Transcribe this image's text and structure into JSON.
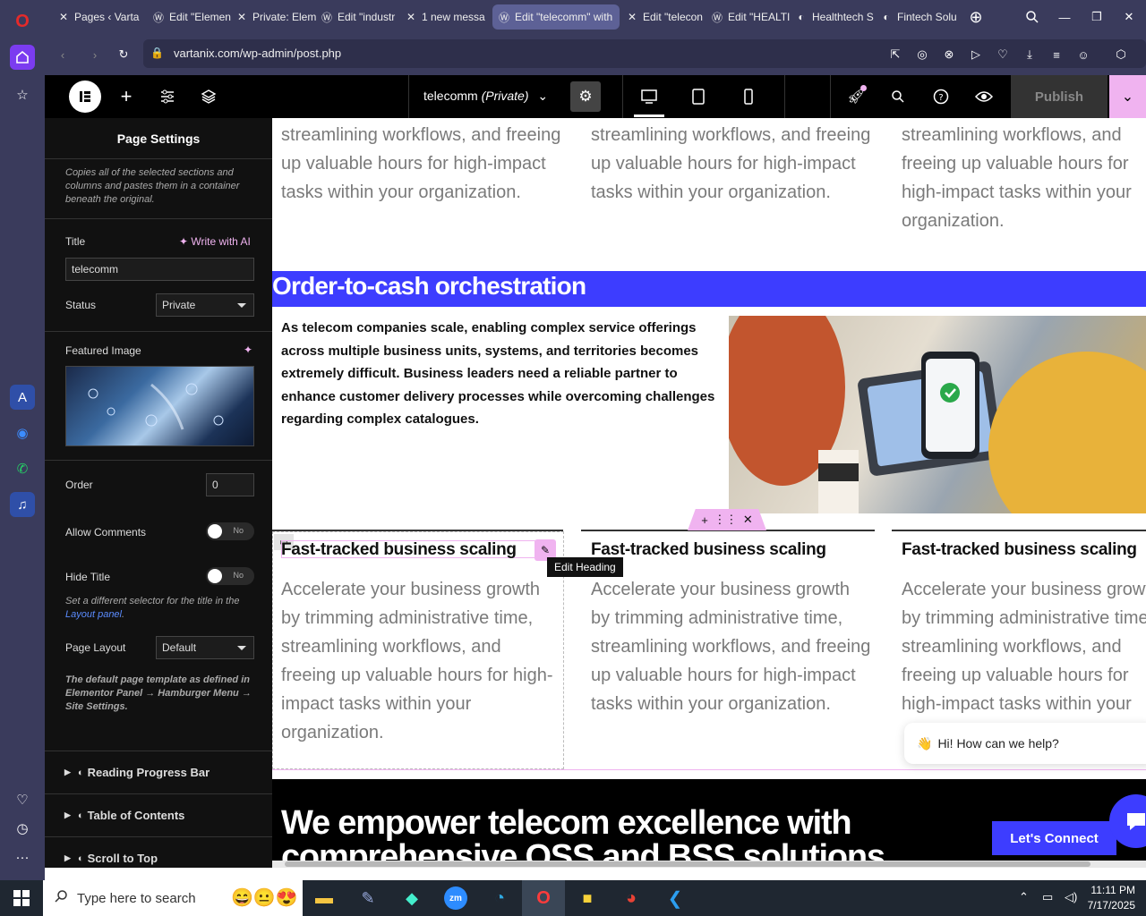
{
  "browser": {
    "tabs": [
      {
        "label": "Pages ‹ Varta",
        "icon": "elementor-x-icon"
      },
      {
        "label": "Edit \"Elemen",
        "icon": "wordpress-icon"
      },
      {
        "label": "Private: Elem",
        "icon": "elementor-x-icon"
      },
      {
        "label": "Edit \"industr",
        "icon": "wordpress-icon"
      },
      {
        "label": "1 new messa",
        "icon": "elementor-x-icon"
      },
      {
        "label": "Edit \"telecomm\" with",
        "icon": "wordpress-icon",
        "active": true
      },
      {
        "label": "Edit \"telecon",
        "icon": "elementor-x-icon"
      },
      {
        "label": "Edit \"HEALTI",
        "icon": "wordpress-icon"
      },
      {
        "label": "Healthtech S",
        "icon": "site-icon"
      },
      {
        "label": "Fintech Solu",
        "icon": "site-icon"
      }
    ],
    "url": "vartanix.com/wp-admin/post.php"
  },
  "editor": {
    "page_title": "telecomm",
    "page_status": "(Private)",
    "publish_label": "Publish"
  },
  "panel": {
    "heading": "Page Settings",
    "copy_note": "Copies all of the selected sections and columns and pastes them in a container beneath the original.",
    "title_label": "Title",
    "write_ai": "Write with AI",
    "title_value": "telecomm",
    "status_label": "Status",
    "status_value": "Private",
    "featured_label": "Featured Image",
    "order_label": "Order",
    "order_value": "0",
    "comments_label": "Allow Comments",
    "comments_toggle": "No",
    "hide_title_label": "Hide Title",
    "hide_title_toggle": "No",
    "hide_note": "Set a different selector for the title in the",
    "layout_link": "Layout panel",
    "layout_label": "Page Layout",
    "layout_value": "Default",
    "layout_note": "The default page template as defined in Elementor Panel → Hamburger Menu → Site Settings.",
    "sections": [
      "Reading Progress Bar",
      "Table of Contents",
      "Scroll to Top"
    ]
  },
  "canvas": {
    "top_text": "streamlining workflows, and freeing up valuable hours for high-impact tasks within your organization.",
    "banner_heading": "Order-to-cash orchestration",
    "intro_text": "As telecom companies scale, enabling complex service offerings across multiple business units, systems, and territories becomes extremely difficult. Business leaders need a reliable partner to enhance customer delivery processes while overcoming challenges regarding complex catalogues.",
    "card_heading": "Fast-tracked business scaling",
    "card_text": "Accelerate your business growth by trimming administrative time, streamlining workflows, and freeing up valuable hours for high-impact tasks within your organization.",
    "edit_tooltip": "Edit Heading",
    "chat_text": "Hi! How can we help?",
    "footer_heading": "We empower telecom excellence with comprehensive OSS and BSS solutions",
    "connect_label": "Let's Connect"
  },
  "taskbar": {
    "search_placeholder": "Type here to search",
    "time": "11:11 PM",
    "date": "7/17/2025"
  },
  "colors": {
    "accent": "#3d3dff",
    "pink": "#f0b3f0",
    "browser": "#3a3b5c"
  }
}
